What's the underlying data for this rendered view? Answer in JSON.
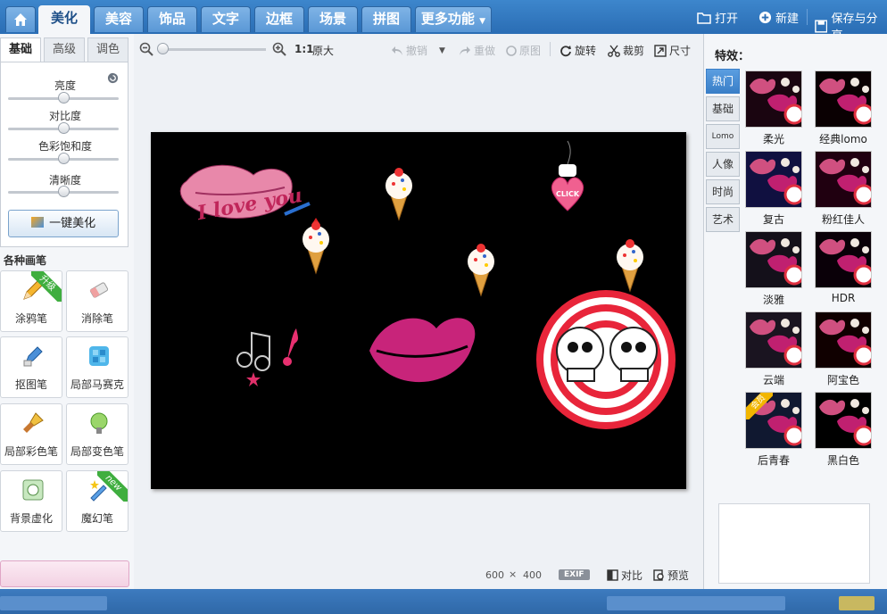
{
  "top_nav": {
    "tabs": [
      {
        "label": "美化",
        "active": true
      },
      {
        "label": "美容",
        "active": false
      },
      {
        "label": "饰品",
        "active": false
      },
      {
        "label": "文字",
        "active": false
      },
      {
        "label": "边框",
        "active": false
      },
      {
        "label": "场景",
        "active": false
      },
      {
        "label": "拼图",
        "active": false
      },
      {
        "label": "更多功能",
        "active": false
      }
    ],
    "open_label": "打开",
    "new_label": "新建",
    "save_label": "保存与分享"
  },
  "left_panel": {
    "subtabs": [
      "基础",
      "高级",
      "调色"
    ],
    "adjustments": [
      {
        "label": "亮度",
        "value": 0.5
      },
      {
        "label": "对比度",
        "value": 0.5
      },
      {
        "label": "色彩饱和度",
        "value": 0.5
      },
      {
        "label": "清晰度",
        "value": 0.5
      }
    ],
    "one_key_label": "一键美化",
    "brush_title": "各种画笔",
    "brushes": [
      {
        "label": "涂鸦笔",
        "icon": "pencil-icon",
        "badge": "升级"
      },
      {
        "label": "消除笔",
        "icon": "eraser-icon",
        "badge": ""
      },
      {
        "label": "抠图笔",
        "icon": "cutout-pen-icon",
        "badge": ""
      },
      {
        "label": "局部马赛克",
        "icon": "mosaic-icon",
        "badge": ""
      },
      {
        "label": "局部彩色笔",
        "icon": "color-brush-icon",
        "badge": ""
      },
      {
        "label": "局部变色笔",
        "icon": "color-change-icon",
        "badge": ""
      },
      {
        "label": "背景虚化",
        "icon": "background-blur-icon",
        "badge": ""
      },
      {
        "label": "魔幻笔",
        "icon": "magic-wand-icon",
        "badge": "new"
      }
    ]
  },
  "toolbar": {
    "zoom_reset": "1:1",
    "original_size": "原大",
    "undo": "撤销",
    "redo": "重做",
    "original": "原图",
    "rotate": "旋转",
    "crop": "裁剪",
    "size": "尺寸"
  },
  "canvas": {
    "love_text": "I love you",
    "click_text": "CLICK"
  },
  "status": {
    "width": "600",
    "times": "×",
    "height": "400",
    "exif_label": "EXIF",
    "compare_label": "对比",
    "preview_label": "预览"
  },
  "right_panel": {
    "title": "特效：",
    "categories": [
      {
        "label": "热门",
        "active": true
      },
      {
        "label": "基础",
        "active": false
      },
      {
        "label": "Lomo",
        "active": false
      },
      {
        "label": "人像",
        "active": false
      },
      {
        "label": "时尚",
        "active": false
      },
      {
        "label": "艺术",
        "active": false
      }
    ],
    "effects": [
      {
        "label": "柔光",
        "tint": "#1a0510"
      },
      {
        "label": "经典lomo",
        "tint": "#0a0002"
      },
      {
        "label": "复古",
        "tint": "#101040"
      },
      {
        "label": "粉红佳人",
        "tint": "#200010"
      },
      {
        "label": "淡雅",
        "tint": "#14101a"
      },
      {
        "label": "HDR",
        "tint": "#0a0008"
      },
      {
        "label": "云端",
        "tint": "#1a1420"
      },
      {
        "label": "阿宝色",
        "tint": "#100000"
      },
      {
        "label": "后青春",
        "tint": "#101830",
        "vip": "会员"
      },
      {
        "label": "黑白色",
        "tint": "#000000"
      }
    ]
  },
  "colors": {
    "topbar": "#2a6db4",
    "accent": "#3a7fc8",
    "lips_pink": "#e05a8c",
    "lips_magenta": "#c8247a",
    "skull_red": "#e8253a"
  }
}
